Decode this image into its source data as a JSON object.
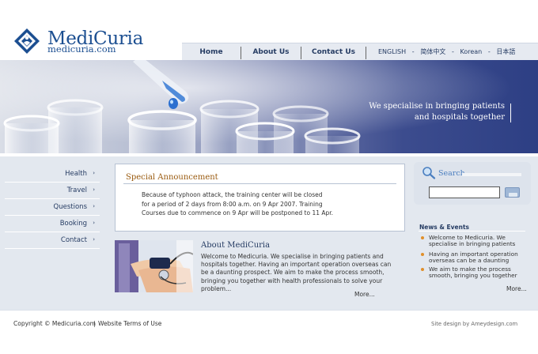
{
  "brand": {
    "name": "MediCuria",
    "url": "medicuria.com"
  },
  "nav": {
    "items": [
      "Home",
      "About Us",
      "Contact Us"
    ],
    "languages": [
      "ENGLISH",
      "简体中文",
      "Korean",
      "日本語"
    ],
    "lang_separator": "-"
  },
  "banner": {
    "tagline_line1": "We specialise in bringing patients",
    "tagline_line2": "and hospitals together"
  },
  "sidebar": {
    "items": [
      {
        "label": "Health"
      },
      {
        "label": "Travel"
      },
      {
        "label": "Questions"
      },
      {
        "label": "Booking"
      },
      {
        "label": "Contact"
      }
    ],
    "arrow": "›"
  },
  "announcement": {
    "title": "Special Announcement",
    "line1": "Because of typhoon attack, the training center will be closed",
    "line2": "for a period of 2 days from 8:00 a.m. on 9 Apr 2007.  Training",
    "line3": "Courses due to commence on 9 Apr will be postponed to 11 Apr."
  },
  "about": {
    "title": "About MediCuria",
    "line1": "Welcome to Medicuria. We specialise in bringing patients and",
    "line2": "hospitals together. Having an important operation overseas can",
    "line3": "be a daunting prospect. We aim to make the process smooth,",
    "line4": "bringing you together with health professionals to solve your",
    "line5": "problem...",
    "more": "More..."
  },
  "search": {
    "label": "Search",
    "value": ""
  },
  "news": {
    "title": "News & Events",
    "items": [
      {
        "line1": "Welcome to Medicuria. We",
        "line2": "specialise in bringing patients"
      },
      {
        "line1": "Having an important operation",
        "line2": "overseas can be a daunting"
      },
      {
        "line1": "We aim to make the process",
        "line2": "smooth, bringing you together"
      }
    ],
    "more": "More..."
  },
  "footer": {
    "copyright": "Copyright ©  Medicuria.com",
    "separator": "|",
    "terms": "Website Terms of Use",
    "site_design": "Site design by Ameydesign.com"
  },
  "colors": {
    "brand_blue": "#1c4f91",
    "nav_text": "#263c63",
    "panel_bg": "#e3e8ef",
    "announcement_title": "#9a5b10",
    "search_label": "#4b7fc0",
    "news_bullet": "#e08f2a"
  }
}
